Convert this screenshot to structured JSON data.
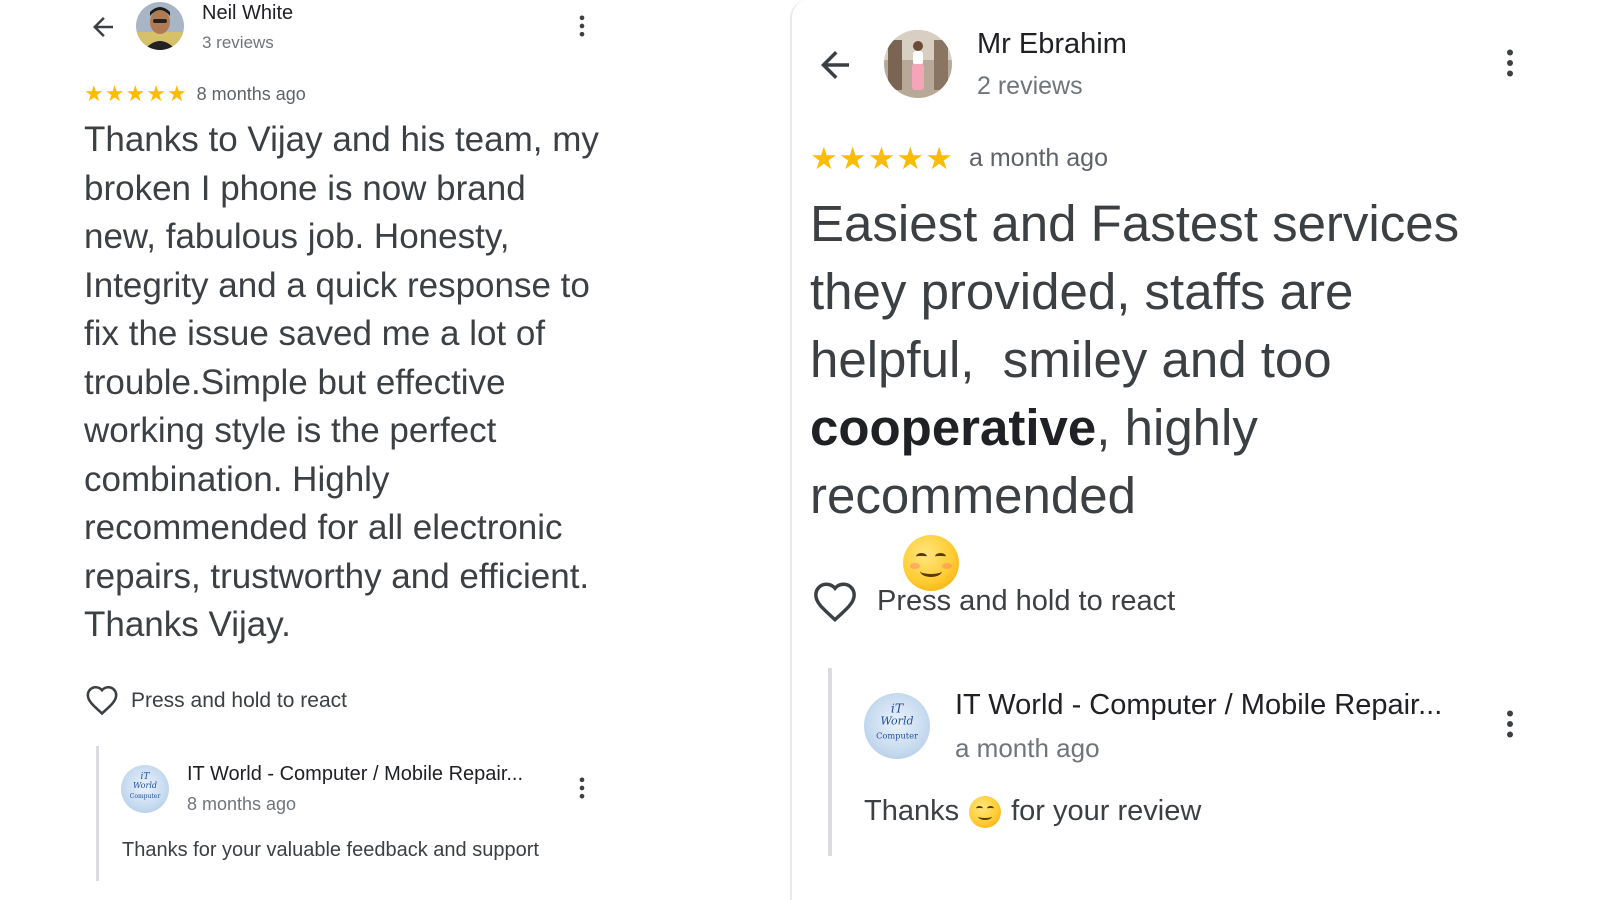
{
  "left": {
    "reviewer": {
      "name": "Neil White",
      "review_count": "3 reviews",
      "avatar_icon": "person-photo-avatar"
    },
    "rating": {
      "stars": 5,
      "time": "8 months ago"
    },
    "review_text": "Thanks to Vijay and his team, my broken I phone is now brand new, fabulous job. Honesty, Integrity and a quick response to fix the issue saved me a lot of trouble.Simple but effective working style is the perfect combination. Highly recommended for all electronic repairs, trustworthy and efficient. Thanks Vijay.",
    "react_label": "Press and hold to react",
    "reply": {
      "business_name": "IT World - Computer / Mobile Repair...",
      "time": "8 months ago",
      "text": "Thanks for your valuable feedback and support"
    }
  },
  "right": {
    "reviewer": {
      "name": "Mr Ebrahim",
      "review_count": "2 reviews",
      "avatar_icon": "person-photo-avatar"
    },
    "rating": {
      "stars": 5,
      "time": "a month ago"
    },
    "review_lines": [
      {
        "text": "Easiest and Fastest services"
      },
      {
        "text": "they provided, staffs are"
      },
      {
        "text": "helpful,  smiley and too"
      },
      {
        "bold": "cooperative",
        "text": ", highly"
      },
      {
        "text": "recommended",
        "emoji": "smiling-face-emoji"
      }
    ],
    "react_label": "Press and hold to react",
    "reply": {
      "business_name": "IT World - Computer / Mobile Repair...",
      "time": "a month ago",
      "text_before": "Thanks",
      "emoji": "smiling-face-emoji",
      "text_after": "for your review"
    }
  },
  "colors": {
    "star": "#fbbc04",
    "text": "#3c4043",
    "secondary": "#70757a"
  }
}
